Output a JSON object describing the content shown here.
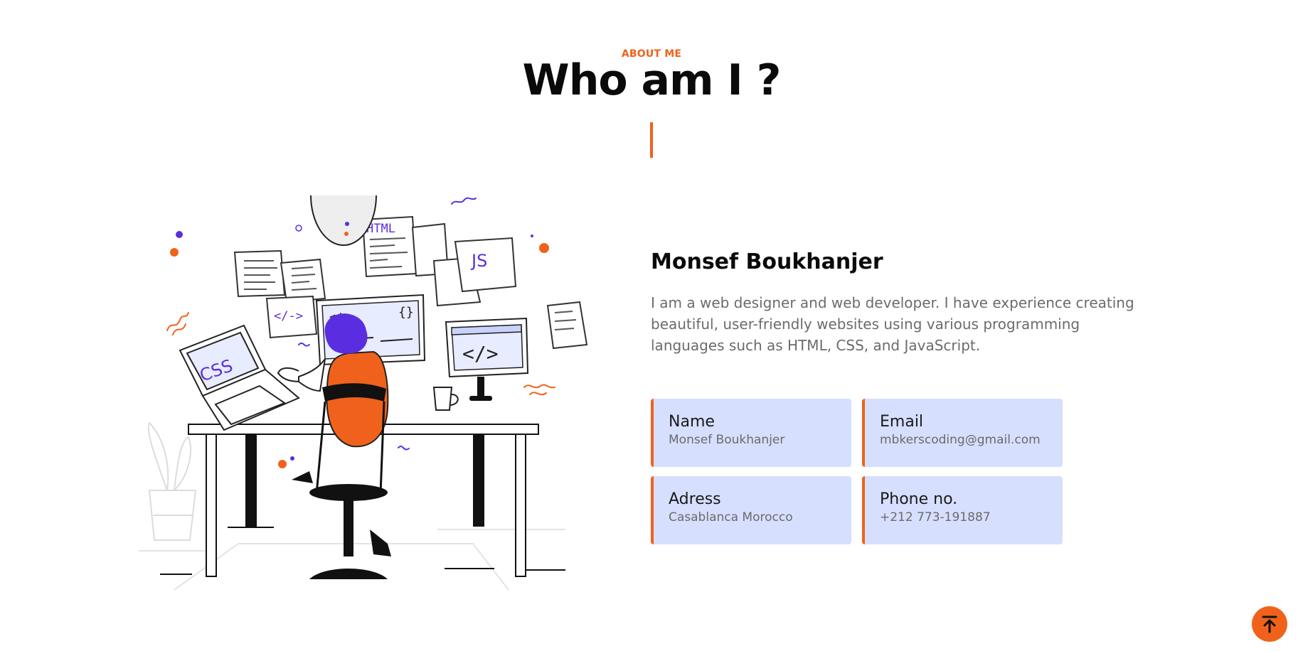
{
  "section": {
    "eyebrow": "ABOUT ME",
    "title": "Who am I ?"
  },
  "illustration": {
    "laptop_text": "CSS",
    "paper_html": "HTML",
    "paper_js": "JS",
    "monitor_code": "</>",
    "paper_code": "</->",
    "screen_code": "</>",
    "screen_brace": "{}"
  },
  "profile": {
    "name": "Monsef Boukhanjer",
    "bio": "I am a web designer and web developer. I have experience creating beautiful, user-friendly websites using various programming languages such as HTML, CSS, and JavaScript."
  },
  "info_cards": [
    {
      "label": "Name",
      "value": "Monsef Boukhanjer"
    },
    {
      "label": "Email",
      "value": "mbkerscoding@gmail.com"
    },
    {
      "label": "Adress",
      "value": "Casablanca Morocco"
    },
    {
      "label": "Phone no.",
      "value": "+212 773-191887"
    }
  ],
  "colors": {
    "accent": "#f0621c",
    "purple": "#5a2ee0",
    "card_bg": "#d6dffd"
  },
  "icons": {
    "scroll_top": "arrow-up-to-line-icon"
  }
}
